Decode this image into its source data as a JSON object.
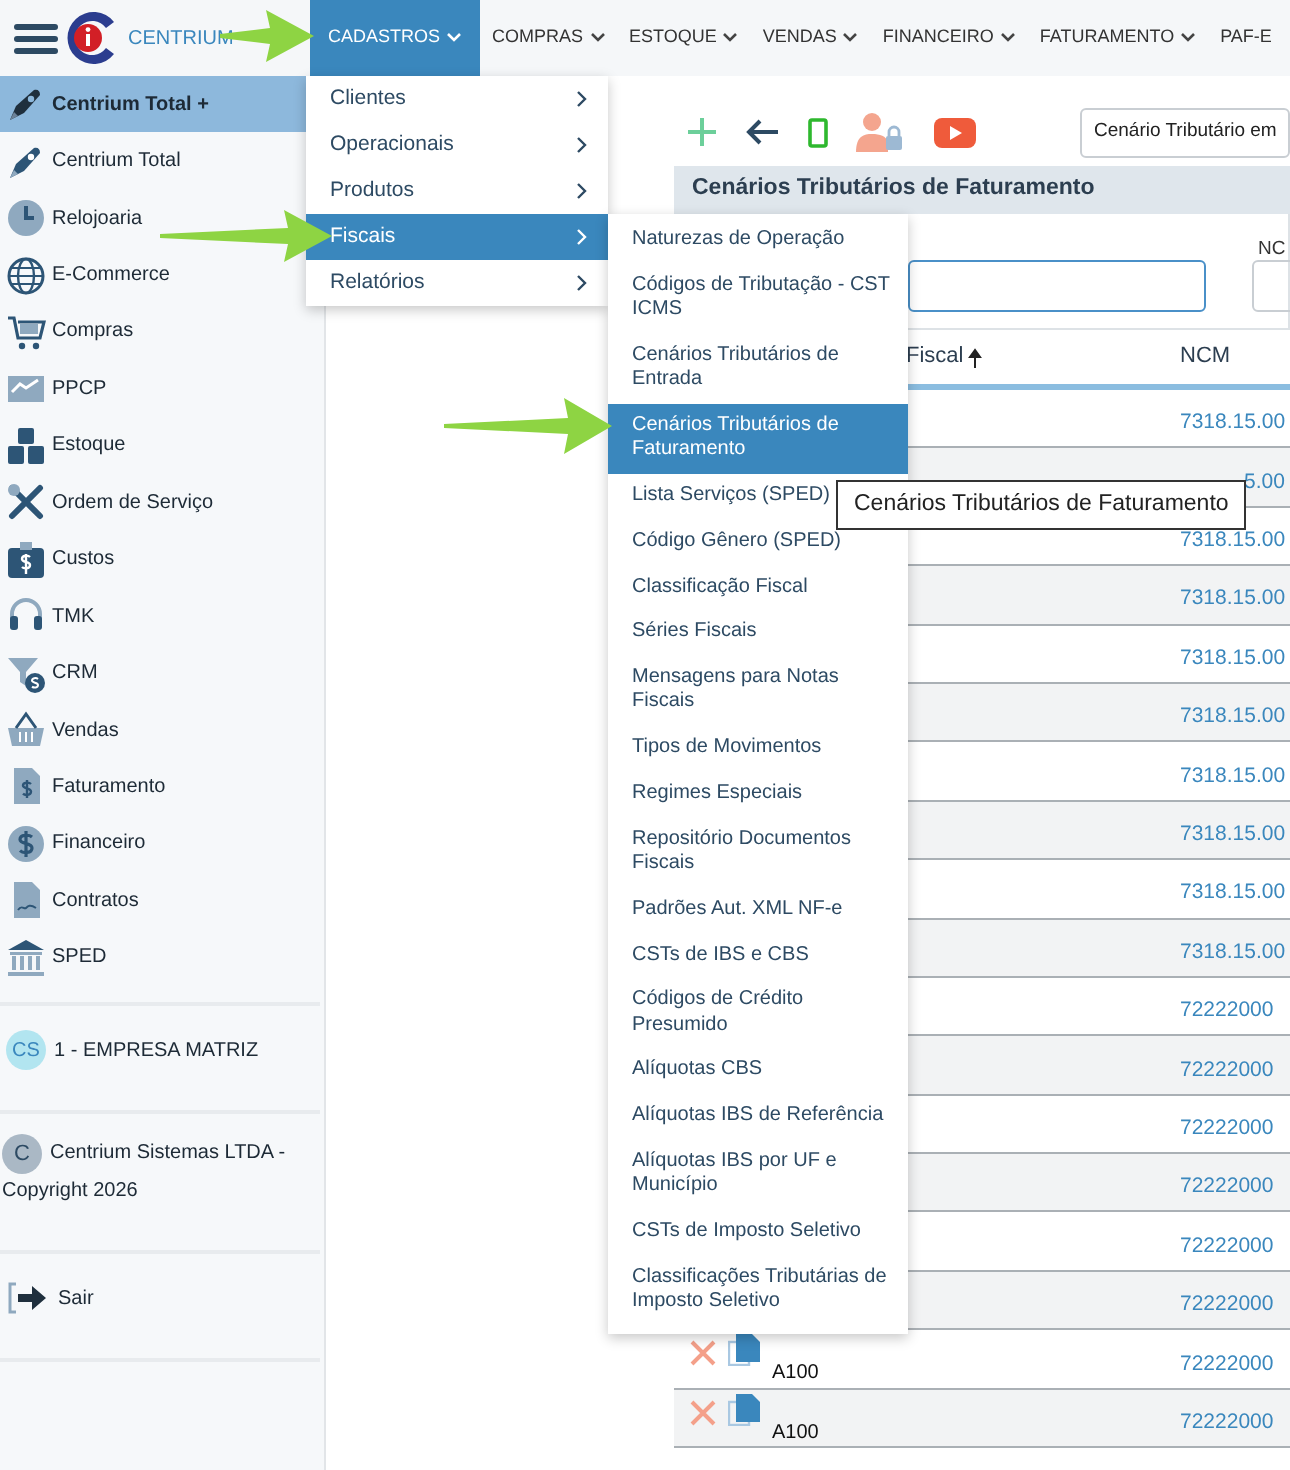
{
  "app": {
    "logo_text": "CENTRIUM"
  },
  "menu_bar": [
    {
      "label": "CADASTROS",
      "selected": true
    },
    {
      "label": "COMPRAS",
      "selected": false
    },
    {
      "label": "ESTOQUE",
      "selected": false
    },
    {
      "label": "VENDAS",
      "selected": false
    },
    {
      "label": "FINANCEIRO",
      "selected": false
    },
    {
      "label": "FATURAMENTO",
      "selected": false
    },
    {
      "label": "PAF-E",
      "selected": false
    }
  ],
  "sidebar": {
    "items": [
      {
        "label": "Centrium Total +",
        "selected": true
      },
      {
        "label": "Centrium Total",
        "selected": false
      },
      {
        "label": "Relojoaria",
        "selected": false
      },
      {
        "label": "E-Commerce",
        "selected": false
      },
      {
        "label": "Compras",
        "selected": false
      },
      {
        "label": "PPCP",
        "selected": false
      },
      {
        "label": "Estoque",
        "selected": false
      },
      {
        "label": "Ordem de Serviço",
        "selected": false
      },
      {
        "label": "Custos",
        "selected": false
      },
      {
        "label": "TMK",
        "selected": false
      },
      {
        "label": "CRM",
        "selected": false
      },
      {
        "label": "Vendas",
        "selected": false
      },
      {
        "label": "Faturamento",
        "selected": false
      },
      {
        "label": "Financeiro",
        "selected": false
      },
      {
        "label": "Contratos",
        "selected": false
      },
      {
        "label": "SPED",
        "selected": false
      }
    ],
    "company_badge": "CS",
    "company": "1 - EMPRESA MATRIZ",
    "copyright_badge": "C",
    "copyright_lines": [
      "Centrium Sistemas LTDA -",
      "Copyright 2026"
    ],
    "logout": "Sair"
  },
  "toolbar": {
    "scenario_select": "Cenário Tributário em"
  },
  "panel": {
    "title": "Cenários Tributários de Faturamento",
    "filter": {
      "ncm_label": "NC"
    },
    "table": {
      "columns": [
        "Fiscal",
        "NCM"
      ],
      "rows": [
        {
          "ncm": "7318.15.00"
        },
        {
          "ncm": "5.00"
        },
        {
          "ncm": "7318.15.00"
        },
        {
          "ncm": "7318.15.00"
        },
        {
          "ncm": "7318.15.00"
        },
        {
          "ncm": "7318.15.00"
        },
        {
          "ncm": "7318.15.00"
        },
        {
          "ncm": "7318.15.00"
        },
        {
          "ncm": "7318.15.00"
        },
        {
          "ncm": "7318.15.00"
        },
        {
          "ncm": "72222000"
        },
        {
          "ncm": "72222000"
        },
        {
          "ncm": "72222000"
        },
        {
          "ncm": "72222000"
        },
        {
          "ncm": "72222000"
        },
        {
          "ncm": "72222000"
        },
        {
          "code": "A100",
          "ncm": "72222000"
        },
        {
          "code": "A100",
          "ncm": "72222000"
        }
      ]
    }
  },
  "dropdown": {
    "items": [
      {
        "label": "Clientes",
        "selected": false
      },
      {
        "label": "Operacionais",
        "selected": false
      },
      {
        "label": "Produtos",
        "selected": false
      },
      {
        "label": "Fiscais",
        "selected": true
      },
      {
        "label": "Relatórios",
        "selected": false
      }
    ]
  },
  "submenu": {
    "items": [
      {
        "label": "Naturezas de Operação",
        "selected": false
      },
      {
        "label": "Códigos de Tributação - CST ICMS",
        "selected": false
      },
      {
        "label": "Cenários Tributários de Entrada",
        "selected": false
      },
      {
        "label": "Cenários Tributários de Faturamento",
        "selected": true
      },
      {
        "label": "Lista Serviços (SPED)",
        "selected": false
      },
      {
        "label": "Código Gênero (SPED)",
        "selected": false
      },
      {
        "label": "Classificação Fiscal",
        "selected": false
      },
      {
        "label": "Séries Fiscais",
        "selected": false
      },
      {
        "label": "Mensagens para Notas Fiscais",
        "selected": false
      },
      {
        "label": "Tipos de Movimentos",
        "selected": false
      },
      {
        "label": "Regimes Especiais",
        "selected": false
      },
      {
        "label": "Repositório Documentos Fiscais",
        "selected": false
      },
      {
        "label": "Padrões Aut. XML NF-e",
        "selected": false
      },
      {
        "label": "CSTs de IBS e CBS",
        "selected": false
      },
      {
        "label": "Códigos de Crédito Presumido",
        "selected": false
      },
      {
        "label": "Alíquotas CBS",
        "selected": false
      },
      {
        "label": "Alíquotas IBS de Referência",
        "selected": false
      },
      {
        "label": "Alíquotas IBS por UF e Município",
        "selected": false
      },
      {
        "label": "CSTs de Imposto Seletivo",
        "selected": false
      },
      {
        "label": "Classificações Tributárias de Imposto Seletivo",
        "selected": false
      }
    ]
  },
  "tooltip": "Cenários Tributários de Faturamento"
}
